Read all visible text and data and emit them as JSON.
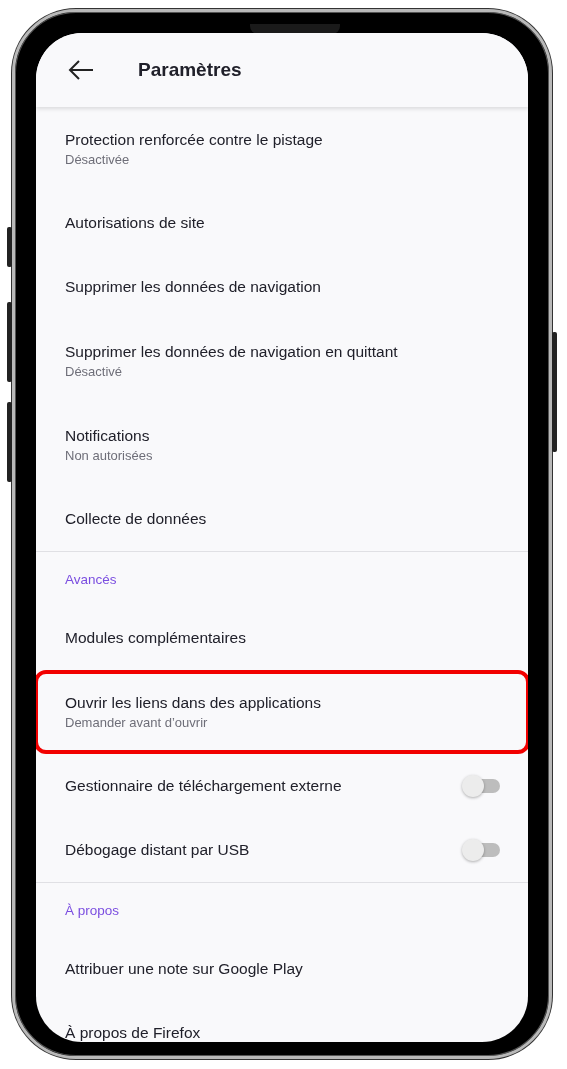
{
  "header": {
    "title": "Paramètres"
  },
  "sections": [
    {
      "items": [
        {
          "kind": "link",
          "title": "Protection renforcée contre le pistage",
          "subtitle": "Désactivée",
          "highlighted": false
        },
        {
          "kind": "link",
          "title": "Autorisations de site",
          "highlighted": false
        },
        {
          "kind": "link",
          "title": "Supprimer les données de navigation",
          "highlighted": false
        },
        {
          "kind": "link",
          "title": "Supprimer les données de navigation en quittant",
          "subtitle": "Désactivé",
          "highlighted": false
        },
        {
          "kind": "link",
          "title": "Notifications",
          "subtitle": "Non autorisées",
          "highlighted": false
        },
        {
          "kind": "link",
          "title": "Collecte de données",
          "highlighted": false
        }
      ]
    },
    {
      "heading": "Avancés",
      "items": [
        {
          "kind": "link",
          "title": "Modules complémentaires",
          "highlighted": false
        },
        {
          "kind": "link",
          "title": "Ouvrir les liens dans des applications",
          "subtitle": "Demander avant d’ouvrir",
          "highlighted": true
        },
        {
          "kind": "toggle",
          "title": "Gestionnaire de téléchargement externe",
          "on": false,
          "highlighted": false
        },
        {
          "kind": "toggle",
          "title": "Débogage distant par USB",
          "on": false,
          "highlighted": false
        }
      ]
    },
    {
      "heading": "À propos",
      "items": [
        {
          "kind": "link",
          "title": "Attribuer une note sur Google Play",
          "highlighted": false
        },
        {
          "kind": "link",
          "title": "À propos de Firefox",
          "highlighted": false
        }
      ]
    }
  ]
}
